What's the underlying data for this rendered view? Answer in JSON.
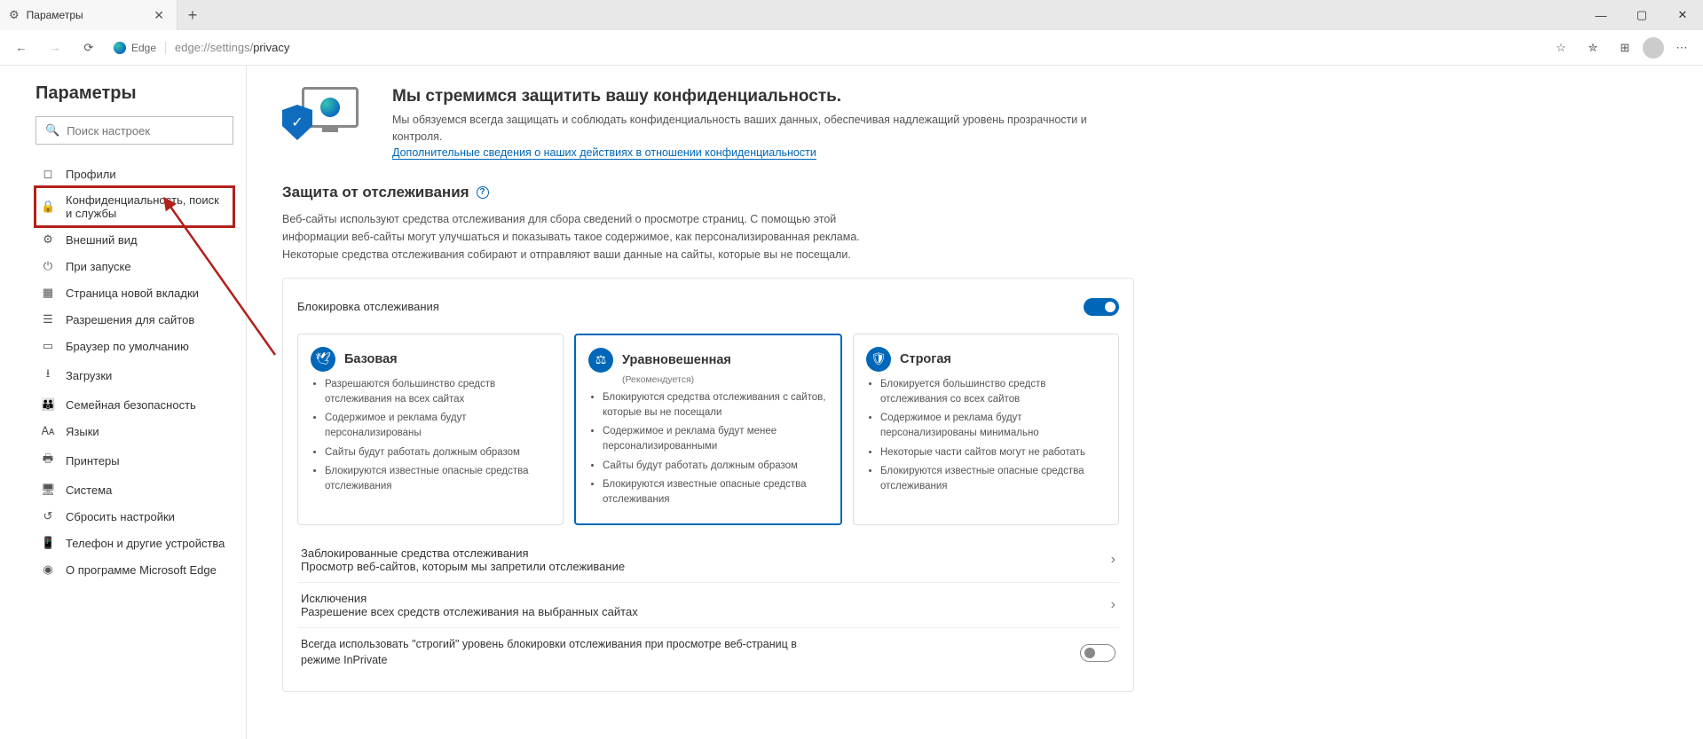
{
  "tab": {
    "title": "Параметры"
  },
  "url": {
    "prefix": "edge://settings/",
    "suffix": "privacy",
    "brand": "Edge"
  },
  "sidebar": {
    "heading": "Параметры",
    "search_placeholder": "Поиск настроек",
    "items": [
      {
        "icon": "◻",
        "label": "Профили"
      },
      {
        "icon": "🔒",
        "label": "Конфиденциальность, поиск и службы"
      },
      {
        "icon": "⚙",
        "label": "Внешний вид"
      },
      {
        "icon": "⏻",
        "label": "При запуске"
      },
      {
        "icon": "▦",
        "label": "Страница новой вкладки"
      },
      {
        "icon": "☰",
        "label": "Разрешения для сайтов"
      },
      {
        "icon": "▭",
        "label": "Браузер по умолчанию"
      },
      {
        "icon": "⭳",
        "label": "Загрузки"
      },
      {
        "icon": "👪",
        "label": "Семейная безопасность"
      },
      {
        "icon": "🗛",
        "label": "Языки"
      },
      {
        "icon": "🖶",
        "label": "Принтеры"
      },
      {
        "icon": "🖥",
        "label": "Система"
      },
      {
        "icon": "↺",
        "label": "Сбросить настройки"
      },
      {
        "icon": "📱",
        "label": "Телефон и другие устройства"
      },
      {
        "icon": "◉",
        "label": "О программе Microsoft Edge"
      }
    ]
  },
  "hero": {
    "title": "Мы стремимся защитить вашу конфиденциальность.",
    "desc": "Мы обязуемся всегда защищать и соблюдать конфиденциальность ваших данных, обеспечивая надлежащий уровень прозрачности и контроля.",
    "link": "Дополнительные сведения о наших действиях в отношении конфиденциальности"
  },
  "tracking": {
    "heading": "Защита от отслеживания",
    "desc": "Веб-сайты используют средства отслеживания для сбора сведений о просмотре страниц. С помощью этой информации веб-сайты могут улучшаться и показывать такое содержимое, как персонализированная реклама. Некоторые средства отслеживания собирают и отправляют ваши данные на сайты, которые вы не посещали.",
    "block_label": "Блокировка отслеживания",
    "levels": [
      {
        "name": "Базовая",
        "bullets": [
          "Разрешаются большинство средств отслеживания на всех сайтах",
          "Содержимое и реклама будут персонализированы",
          "Сайты будут работать должным образом",
          "Блокируются известные опасные средства отслеживания"
        ]
      },
      {
        "name": "Уравновешенная",
        "sub": "(Рекомендуется)",
        "bullets": [
          "Блокируются средства отслеживания с сайтов, которые вы не посещали",
          "Содержимое и реклама будут менее персонализированными",
          "Сайты будут работать должным образом",
          "Блокируются известные опасные средства отслеживания"
        ]
      },
      {
        "name": "Строгая",
        "bullets": [
          "Блокируется большинство средств отслеживания со всех сайтов",
          "Содержимое и реклама будут персонализированы минимально",
          "Некоторые части сайтов могут не работать",
          "Блокируются известные опасные средства отслеживания"
        ]
      }
    ],
    "blocked": {
      "title": "Заблокированные средства отслеживания",
      "sub": "Просмотр веб-сайтов, которым мы запретили отслеживание"
    },
    "exceptions": {
      "title": "Исключения",
      "sub": "Разрешение всех средств отслеживания на выбранных сайтах"
    },
    "inprivate": "Всегда использовать \"строгий\" уровень блокировки отслеживания при просмотре веб-страниц в режиме InPrivate"
  }
}
